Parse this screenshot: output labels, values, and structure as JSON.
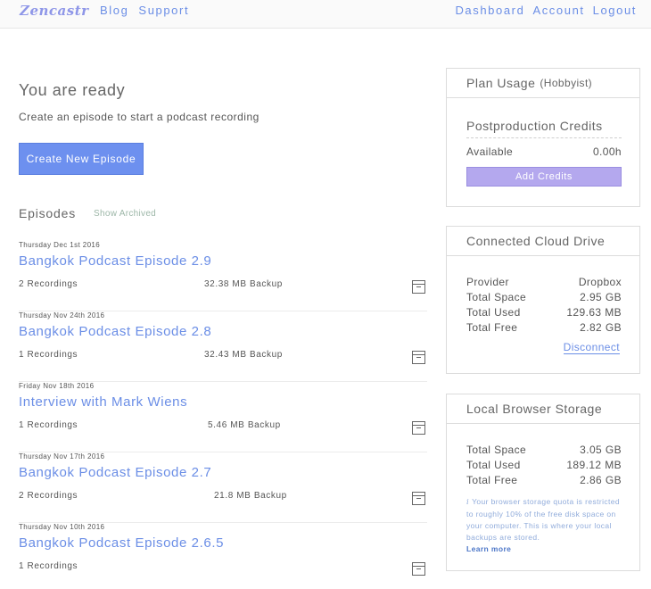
{
  "nav": {
    "logo": "Zencastr",
    "left_links": [
      "Blog",
      "Support"
    ],
    "right_links": [
      "Dashboard",
      "Account",
      "Logout"
    ]
  },
  "main": {
    "title": "You are ready",
    "subtitle": "Create an episode to start a podcast recording",
    "create_button": "Create New Episode",
    "episodes_heading": "Episodes",
    "show_archived": "Show Archived",
    "episodes": [
      {
        "date": "Thursday Dec 1st 2016",
        "title": "Bangkok Podcast Episode 2.9",
        "recordings": "2 Recordings",
        "backup": "32.38 MB Backup"
      },
      {
        "date": "Thursday Nov 24th 2016",
        "title": "Bangkok Podcast Episode 2.8",
        "recordings": "1 Recordings",
        "backup": "32.43 MB Backup"
      },
      {
        "date": "Friday Nov 18th 2016",
        "title": "Interview with Mark Wiens",
        "recordings": "1 Recordings",
        "backup": "5.46 MB Backup"
      },
      {
        "date": "Thursday Nov 17th 2016",
        "title": "Bangkok Podcast Episode 2.7",
        "recordings": "2 Recordings",
        "backup": "21.8 MB Backup"
      },
      {
        "date": "Thursday Nov 10th 2016",
        "title": "Bangkok Podcast Episode 2.6.5",
        "recordings": "1 Recordings",
        "backup": ""
      }
    ]
  },
  "plan": {
    "title": "Plan Usage",
    "tier": "(Hobbyist)",
    "postproduction_title": "Postproduction Credits",
    "available_label": "Available",
    "available_value": "0.00h",
    "add_credits": "Add Credits"
  },
  "cloud": {
    "title": "Connected Cloud Drive",
    "rows": [
      {
        "label": "Provider",
        "value": "Dropbox"
      },
      {
        "label": "Total Space",
        "value": "2.95 GB"
      },
      {
        "label": "Total Used",
        "value": "129.63 MB"
      },
      {
        "label": "Total Free",
        "value": "2.82 GB"
      }
    ],
    "disconnect": "Disconnect"
  },
  "local": {
    "title": "Local Browser Storage",
    "rows": [
      {
        "label": "Total Space",
        "value": "3.05 GB"
      },
      {
        "label": "Total Used",
        "value": "189.12 MB"
      },
      {
        "label": "Total Free",
        "value": "2.86 GB"
      }
    ],
    "note_icon": "i",
    "note": "Your browser storage quota is restricted to roughly 10% of the free disk space on your computer. This is where your local backups are stored.",
    "learn_more": "Learn more"
  },
  "colors": {
    "accent": "#6b8ee6",
    "button": "#6d90ef",
    "add_credits": "#b4a8ee"
  }
}
